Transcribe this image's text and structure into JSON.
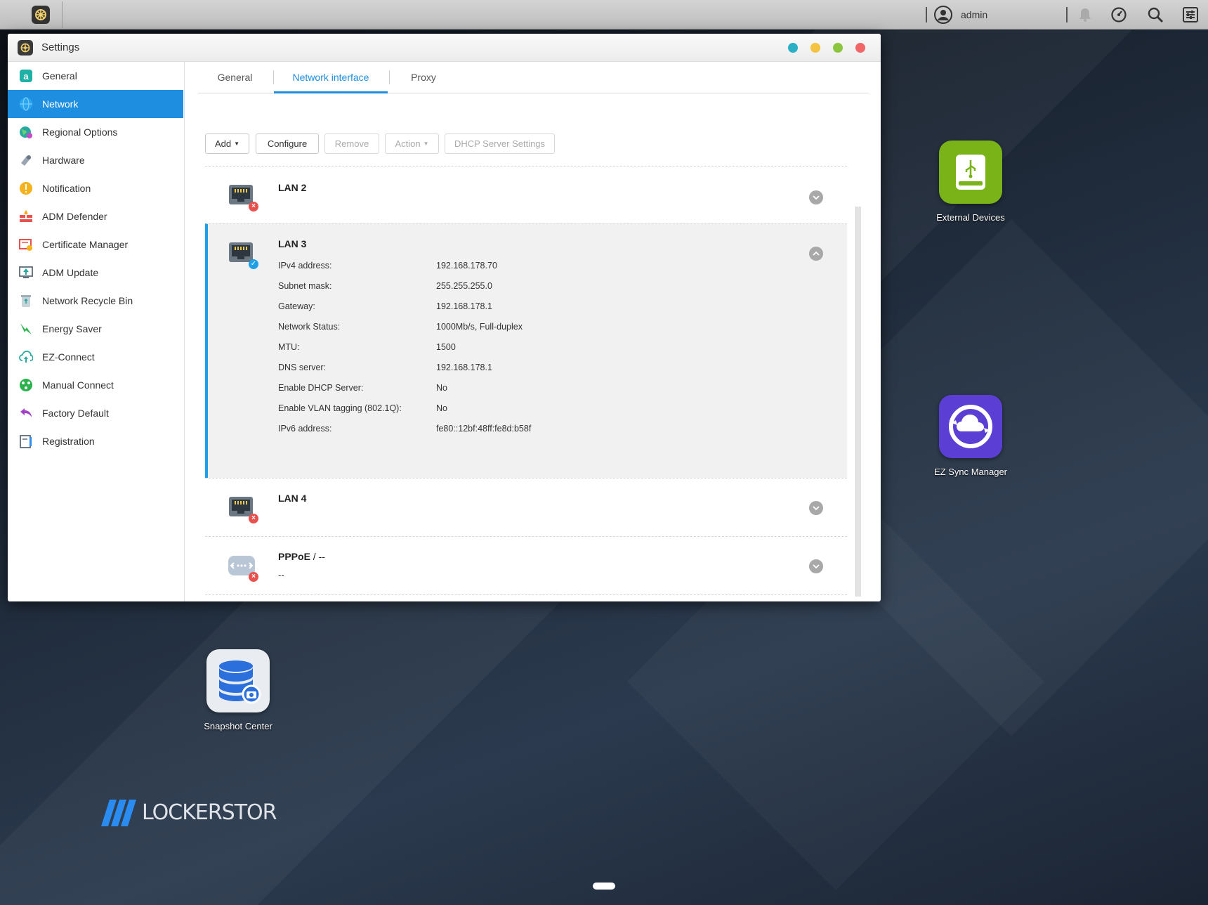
{
  "topbar": {
    "user_name": "admin"
  },
  "window": {
    "title": "Settings"
  },
  "sidebar": {
    "items": [
      {
        "label": "General",
        "icon": "general-icon"
      },
      {
        "label": "Network",
        "icon": "network-icon",
        "active": true
      },
      {
        "label": "Regional Options",
        "icon": "regional-options-icon"
      },
      {
        "label": "Hardware",
        "icon": "hardware-icon"
      },
      {
        "label": "Notification",
        "icon": "notification-icon"
      },
      {
        "label": "ADM Defender",
        "icon": "adm-defender-icon"
      },
      {
        "label": "Certificate Manager",
        "icon": "certificate-manager-icon"
      },
      {
        "label": "ADM Update",
        "icon": "adm-update-icon"
      },
      {
        "label": "Network Recycle Bin",
        "icon": "network-recycle-bin-icon"
      },
      {
        "label": "Energy Saver",
        "icon": "energy-saver-icon"
      },
      {
        "label": "EZ-Connect",
        "icon": "ez-connect-icon"
      },
      {
        "label": "Manual Connect",
        "icon": "manual-connect-icon"
      },
      {
        "label": "Factory Default",
        "icon": "factory-default-icon"
      },
      {
        "label": "Registration",
        "icon": "registration-icon"
      }
    ]
  },
  "tabs": [
    {
      "label": "General"
    },
    {
      "label": "Network interface",
      "active": true
    },
    {
      "label": "Proxy"
    }
  ],
  "toolbar": {
    "add": "Add",
    "configure": "Configure",
    "remove": "Remove",
    "action": "Action",
    "dhcp": "DHCP Server Settings"
  },
  "interfaces": {
    "lan2": {
      "name": "LAN 2",
      "status": "disconnected"
    },
    "lan3": {
      "name": "LAN 3",
      "status": "connected",
      "details": [
        {
          "label": "IPv4 address:",
          "value": "192.168.178.70"
        },
        {
          "label": "Subnet mask:",
          "value": "255.255.255.0"
        },
        {
          "label": "Gateway:",
          "value": "192.168.178.1"
        },
        {
          "label": "Network Status:",
          "value": "1000Mb/s, Full-duplex"
        },
        {
          "label": "MTU:",
          "value": "1500"
        },
        {
          "label": "DNS server:",
          "value": "192.168.178.1"
        },
        {
          "label": "Enable DHCP Server:",
          "value": "No"
        },
        {
          "label": "Enable VLAN tagging (802.1Q):",
          "value": "No"
        },
        {
          "label": "IPv6 address:",
          "value": "fe80::12bf:48ff:fe8d:b58f"
        }
      ]
    },
    "lan4": {
      "name": "LAN 4",
      "status": "disconnected"
    },
    "pppoe": {
      "name": "PPPoE",
      "suffix": " / --",
      "value": "--",
      "status": "disconnected"
    }
  },
  "desktop": {
    "external_devices": "External Devices",
    "ez_sync": "EZ Sync Manager",
    "snapshot": "Snapshot Center",
    "logo": "LOCKERSTOR"
  },
  "colors": {
    "accent": "#1e8fe0",
    "error": "#e8524e",
    "external_devices_tile": "#7ab317",
    "ez_sync_tile": "#5b3fd4",
    "snapshot_tile": "#e9ecf1"
  }
}
